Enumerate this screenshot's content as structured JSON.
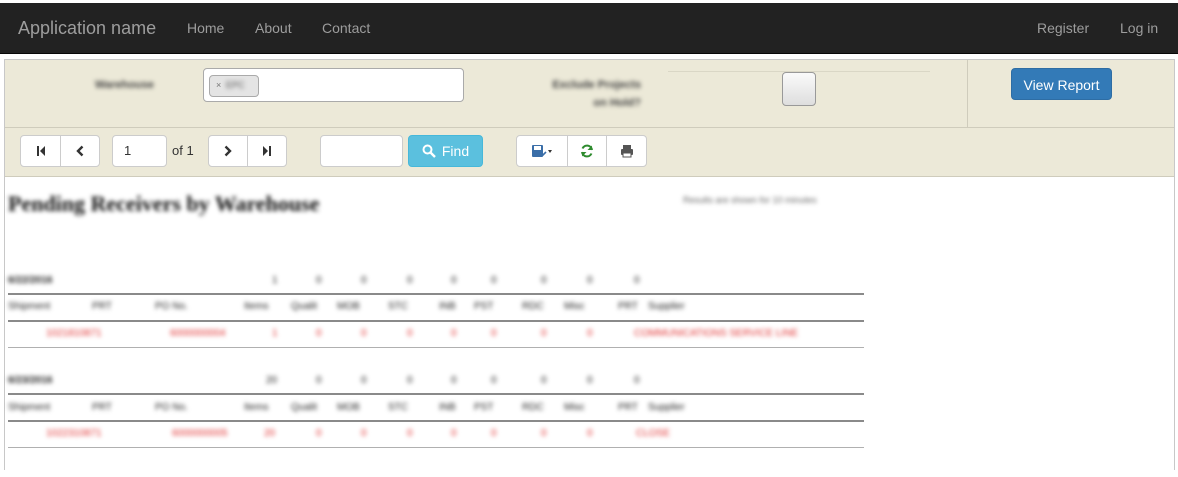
{
  "navbar": {
    "brand": "Application name",
    "links": [
      "Home",
      "About",
      "Contact"
    ],
    "right_links": [
      "Register",
      "Log in"
    ]
  },
  "params": {
    "warehouse_label": "Warehouse",
    "warehouse_chip": "EPC",
    "exclude_label_1": "Exclude Projects",
    "exclude_label_2": "on Hold?",
    "view_report": "View Report"
  },
  "toolbar": {
    "page_value": "1",
    "of_label": "of 1",
    "find_label": "Find"
  },
  "report": {
    "title": "Pending Receivers by Warehouse",
    "note": "Results are shown for 10 minutes",
    "groups": [
      {
        "date": "6/22/2016",
        "totals": [
          "1",
          "0",
          "0",
          "0",
          "0",
          "0",
          "0",
          "0",
          "0"
        ],
        "headers": [
          "Shipment",
          "PRT",
          "PO No.",
          "Items",
          "Qualit",
          "MOB",
          "STC",
          "INB",
          "PST",
          "RDC",
          "Misc",
          "PRT",
          "Supplier"
        ],
        "row": [
          "1021810871",
          "6000000004",
          "1",
          "0",
          "0",
          "0",
          "0",
          "0",
          "0",
          "0",
          "COMMUNICATIONS SERVICE LINE"
        ]
      },
      {
        "date": "6/23/2016",
        "totals": [
          "20",
          "0",
          "0",
          "0",
          "0",
          "0",
          "0",
          "0",
          "0"
        ],
        "headers": [
          "Shipment",
          "PRT",
          "PO No.",
          "Items",
          "Qualit",
          "MOB",
          "STC",
          "INB",
          "PST",
          "RDC",
          "Misc",
          "PRT",
          "Supplier"
        ],
        "row": [
          "1022310871",
          "6000000005",
          "20",
          "0",
          "0",
          "0",
          "0",
          "0",
          "0",
          "0",
          "CLOSE"
        ]
      }
    ]
  }
}
